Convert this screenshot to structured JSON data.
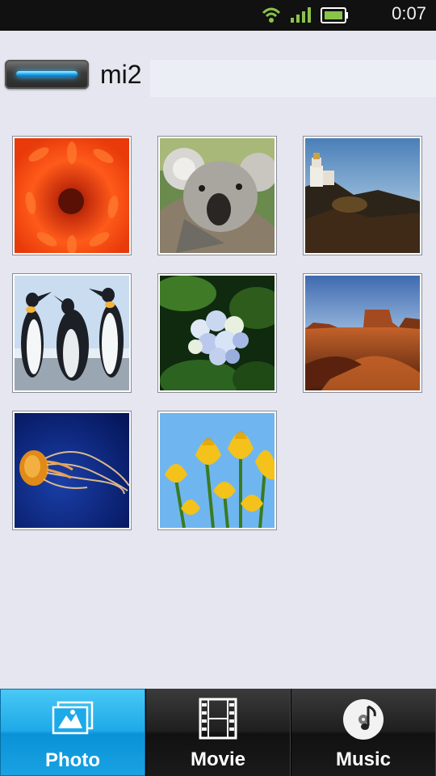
{
  "status_bar": {
    "time": "0:07",
    "icons": [
      "wifi-icon",
      "signal-icon",
      "battery-icon"
    ]
  },
  "header": {
    "device_name": "mi2"
  },
  "photos": [
    {
      "name": "photo-chrysanthemum"
    },
    {
      "name": "photo-koala"
    },
    {
      "name": "photo-lighthouse"
    },
    {
      "name": "photo-penguins"
    },
    {
      "name": "photo-hydrangeas"
    },
    {
      "name": "photo-desert"
    },
    {
      "name": "photo-jellyfish"
    },
    {
      "name": "photo-tulips"
    }
  ],
  "tabs": [
    {
      "label": "Photo",
      "icon": "photo-icon",
      "active": true
    },
    {
      "label": "Movie",
      "icon": "film-icon",
      "active": false
    },
    {
      "label": "Music",
      "icon": "music-icon",
      "active": false
    }
  ],
  "colors": {
    "background": "#e5e6ef",
    "active_tab": "#1ea9e8",
    "status_bar": "#111111",
    "accent_green": "#8bc34a"
  }
}
